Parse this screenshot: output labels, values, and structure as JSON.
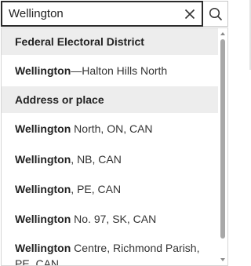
{
  "search": {
    "value": "Wellington",
    "clear_icon": "close-icon",
    "search_icon": "search-icon"
  },
  "results": {
    "groups": [
      {
        "header": "Federal Electoral District",
        "items": [
          {
            "bold": "Wellington",
            "rest": "—Halton Hills North"
          }
        ]
      },
      {
        "header": "Address or place",
        "items": [
          {
            "bold": "Wellington",
            "rest": " North, ON, CAN"
          },
          {
            "bold": "Wellington",
            "rest": ", NB, CAN"
          },
          {
            "bold": "Wellington",
            "rest": ", PE, CAN"
          },
          {
            "bold": "Wellington",
            "rest": " No. 97, SK, CAN"
          },
          {
            "bold": "Wellington",
            "rest": " Centre, Richmond Parish, PE, CAN"
          }
        ]
      }
    ]
  }
}
